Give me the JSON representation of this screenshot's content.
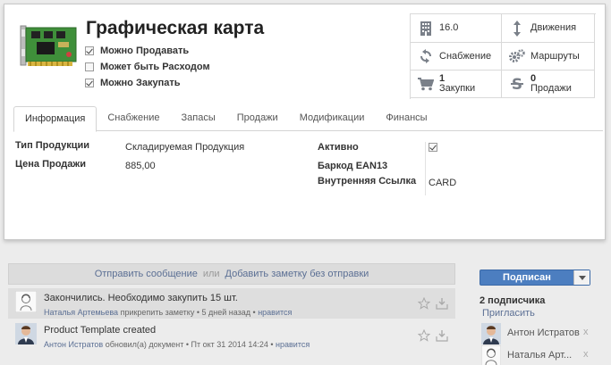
{
  "product": {
    "title": "Графическая карта",
    "checkboxes": [
      {
        "label": "Можно Продавать",
        "checked": true
      },
      {
        "label": "Может быть Расходом",
        "checked": false
      },
      {
        "label": "Можно Закупать",
        "checked": true
      }
    ]
  },
  "smart_buttons": [
    {
      "label": "16.0",
      "icon": "building-icon"
    },
    {
      "label": "Движения",
      "icon": "arrows-vertical-icon"
    },
    {
      "label": "Снабжение",
      "icon": "refresh-icon"
    },
    {
      "label": "Маршруты",
      "icon": "gears-icon"
    },
    {
      "count": "1",
      "label": "Закупки",
      "icon": "shopping-cart-icon"
    },
    {
      "count": "0",
      "label": "Продажи",
      "icon": "dollar-icon"
    }
  ],
  "tabs": [
    "Информация",
    "Снабжение",
    "Запасы",
    "Продажи",
    "Модификации",
    "Финансы"
  ],
  "fields": {
    "product_type_label": "Тип Продукции",
    "product_type_value": "Складируемая Продукция",
    "sale_price_label": "Цена Продажи",
    "sale_price_value": "885,00",
    "active_label": "Активно",
    "barcode_label": "Баркод EAN13",
    "internal_ref_label": "Внутренняя Ссылка",
    "internal_ref_value": "CARD"
  },
  "chatter": {
    "send_message": "Отправить сообщение",
    "or": "или",
    "log_note": "Добавить заметку без отправки",
    "messages": [
      {
        "text": "Закончились. Необходимо закупить 15 шт.",
        "author": "Наталья Артемьева",
        "action": "прикрепить заметку",
        "time": "5 дней назад",
        "like": "нравится"
      },
      {
        "text": "Product Template created",
        "author": "Антон Истратов",
        "action": "обновил(а) документ",
        "time": "Пт окт 31 2014 14:24",
        "like": "нравится"
      }
    ]
  },
  "followers": {
    "button_label": "Подписан",
    "count_label": "2 подписчика",
    "invite": "Пригласить",
    "list": [
      {
        "name": "Антон Истратов",
        "remove": "x"
      },
      {
        "name": "Наталья Арт...",
        "remove": "x"
      }
    ]
  },
  "colors": {
    "accent": "#4c7ec0",
    "link": "#5b6f94",
    "highlight_row": "#dedede"
  }
}
